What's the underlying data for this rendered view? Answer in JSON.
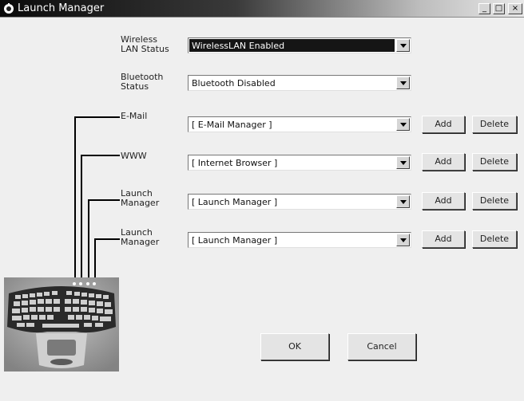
{
  "window": {
    "title": "Launch Manager"
  },
  "title_buttons": {
    "minimize": "_",
    "maximize": "□",
    "close": "×"
  },
  "wireless": {
    "label": "Wireless LAN Status",
    "value": "WirelessLAN Enabled"
  },
  "bluetooth": {
    "label": "Bluetooth Status",
    "value": "Bluetooth Disabled"
  },
  "buttons_rows": [
    {
      "label": "E-Mail",
      "value": "[ E-Mail Manager ]",
      "add": "Add",
      "delete": "Delete"
    },
    {
      "label": "WWW",
      "value": "[ Internet Browser ]",
      "add": "Add",
      "delete": "Delete"
    },
    {
      "label": "Launch Manager",
      "value": "[ Launch Manager ]",
      "add": "Add",
      "delete": "Delete"
    },
    {
      "label": "Launch Manager",
      "value": "[ Launch Manager ]",
      "add": "Add",
      "delete": "Delete"
    }
  ],
  "actions": {
    "ok": "OK",
    "cancel": "Cancel"
  },
  "icons": [
    "app-icon",
    "chevron-down-icon",
    "keyboard-image"
  ]
}
